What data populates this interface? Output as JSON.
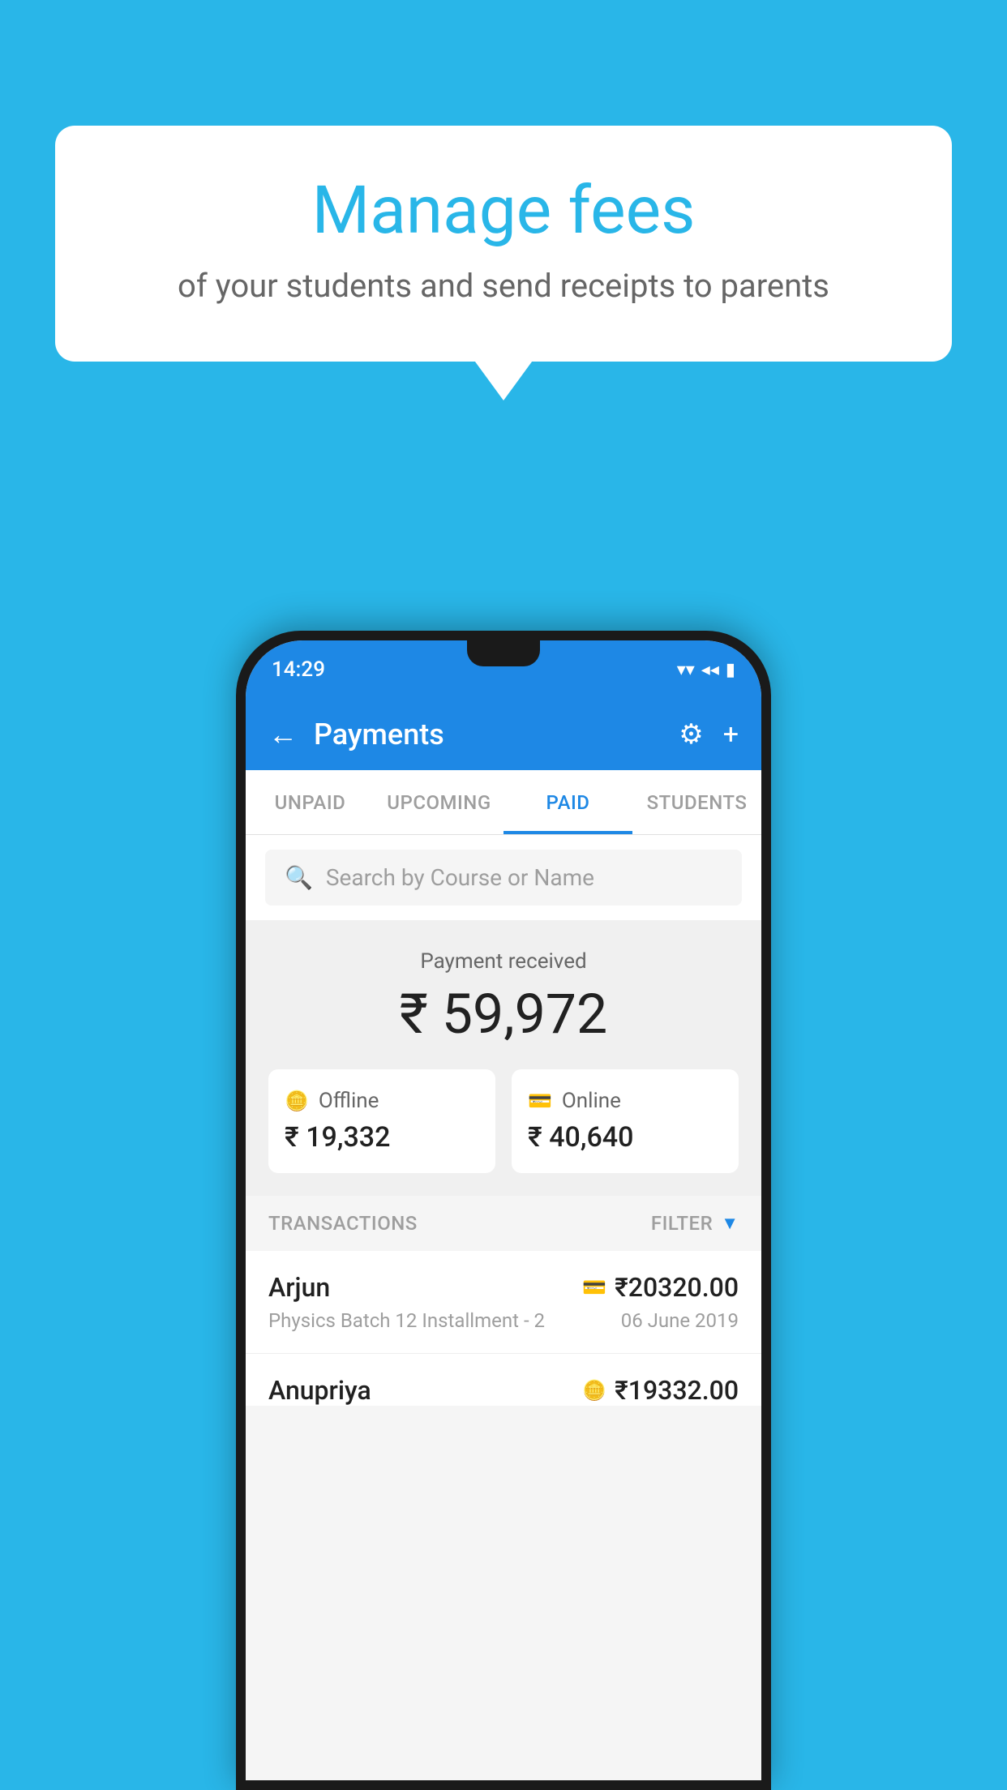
{
  "background": {
    "color": "#29b6e8"
  },
  "speech_bubble": {
    "title": "Manage fees",
    "subtitle": "of your students and send receipts to parents"
  },
  "phone": {
    "status_bar": {
      "time": "14:29",
      "wifi": "▾",
      "signal": "◂",
      "battery": "▮"
    },
    "header": {
      "back_label": "←",
      "title": "Payments",
      "gear_label": "⚙",
      "plus_label": "+"
    },
    "tabs": [
      {
        "label": "UNPAID",
        "active": false
      },
      {
        "label": "UPCOMING",
        "active": false
      },
      {
        "label": "PAID",
        "active": true
      },
      {
        "label": "STUDENTS",
        "active": false
      }
    ],
    "search": {
      "placeholder": "Search by Course or Name"
    },
    "payment_summary": {
      "label": "Payment received",
      "amount": "₹ 59,972",
      "offline_label": "Offline",
      "offline_amount": "₹ 19,332",
      "online_label": "Online",
      "online_amount": "₹ 40,640"
    },
    "transactions": {
      "header_label": "TRANSACTIONS",
      "filter_label": "FILTER",
      "items": [
        {
          "name": "Arjun",
          "payment_type": "card",
          "amount": "₹20320.00",
          "course": "Physics Batch 12 Installment - 2",
          "date": "06 June 2019"
        },
        {
          "name": "Anupriya",
          "payment_type": "cash",
          "amount": "₹19332.00",
          "course": "",
          "date": ""
        }
      ]
    }
  }
}
